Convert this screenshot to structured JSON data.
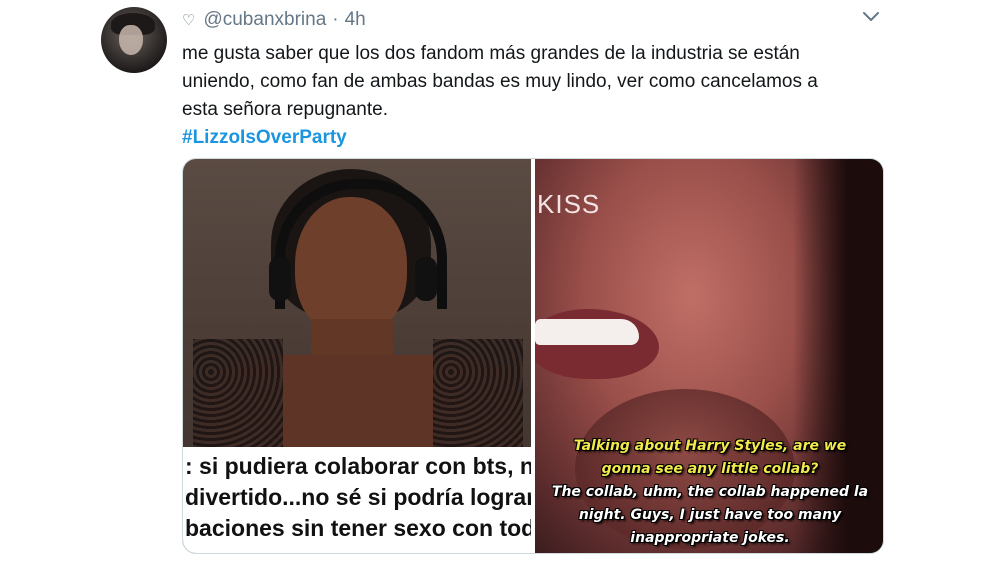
{
  "tweet": {
    "author_handle": "@cubanxbrina",
    "separator": "·",
    "time": "4h",
    "liked_icon": "heart-outline-icon",
    "menu_icon": "chevron-down-icon",
    "text_lines": [
      "me gusta saber que los dos fandom más grandes de la industria se están",
      "uniendo, como fan de ambas bandas es muy lindo, ver como cancelamos a",
      "esta señora repugnante."
    ],
    "hashtag": "#LizzoIsOverParty",
    "colors": {
      "meta": "#657786",
      "text": "#14171a",
      "hashtag": "#1b95e0"
    }
  },
  "media": {
    "left": {
      "caption_lines": [
        ": si pudiera colaborar con bts, no",
        "divertido...no sé si podría lograr l",
        "baciones sin tener sexo con todo"
      ]
    },
    "right": {
      "overlay_label": "KISS",
      "subtitle_yellow": [
        "Talking about Harry Styles, are we",
        "gonna see any little collab?"
      ],
      "subtitle_white": [
        "The collab, uhm, the collab happened la",
        "night. Guys, I just have too many",
        "inappropriate jokes."
      ]
    }
  }
}
